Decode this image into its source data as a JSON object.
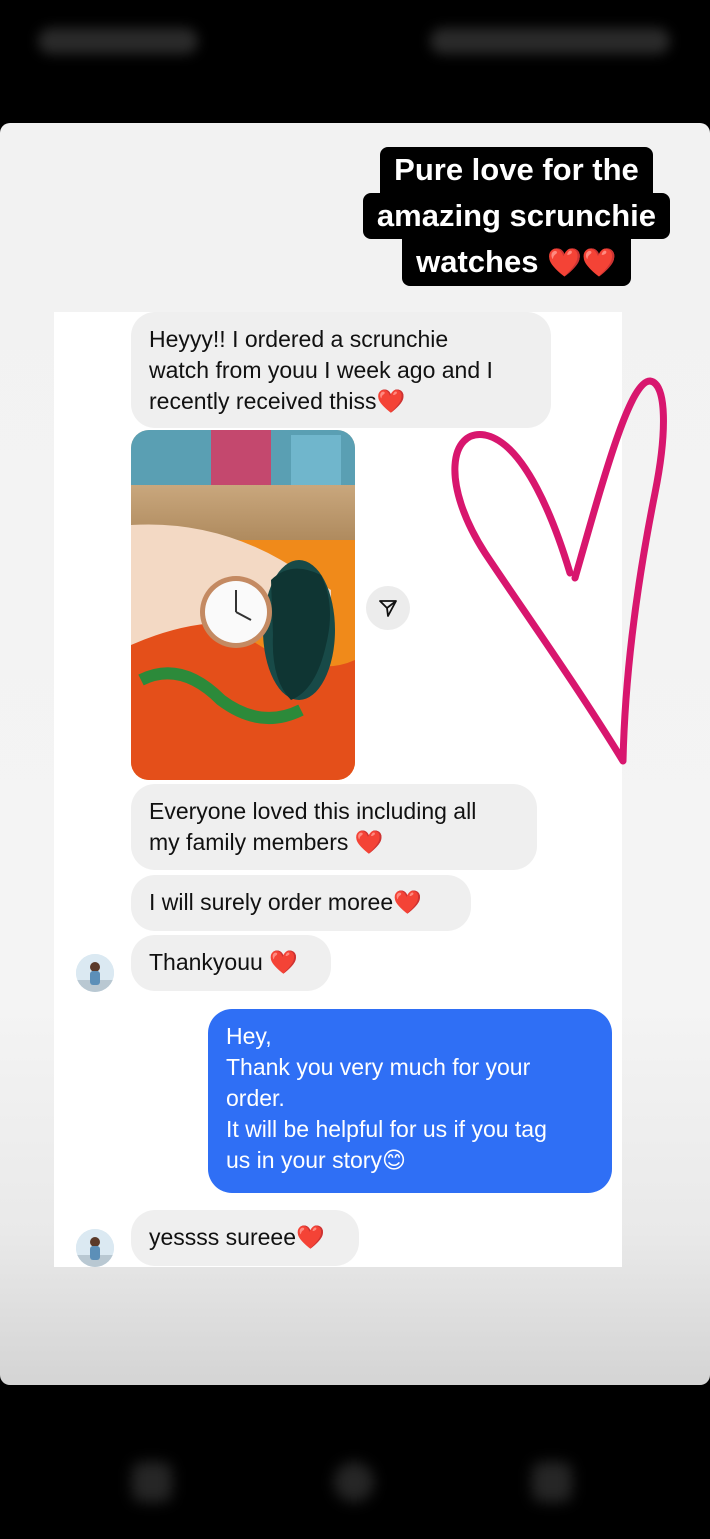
{
  "status_bar": {
    "time": "2:30",
    "icons": [
      "notification-icons",
      "battery-signal-icons"
    ]
  },
  "story": {
    "caption_lines": [
      "Pure love for the",
      "amazing scrunchie",
      "watches"
    ],
    "caption_emoji": "❤️❤️",
    "decoration": "pink-heart-drawing"
  },
  "chat": {
    "messages": [
      {
        "direction": "incoming",
        "lines": [
          "Heyyy!! I ordered a scrunchie",
          "watch from youu I week ago and I",
          "recently received thiss"
        ],
        "emoji": "❤️"
      },
      {
        "direction": "incoming",
        "type": "photo",
        "description_icon": "scrunchie-watch-photo"
      },
      {
        "direction": "incoming",
        "lines": [
          "Everyone loved this including all",
          "my family members"
        ],
        "emoji": "❤️"
      },
      {
        "direction": "incoming",
        "lines": [
          "I will surely order moree"
        ],
        "emoji": "❤️"
      },
      {
        "direction": "incoming",
        "lines": [
          "Thankyouu"
        ],
        "emoji": "❤️"
      },
      {
        "direction": "outgoing",
        "lines": [
          "Hey,",
          "Thank you very much for your",
          "order.",
          "It will be helpful for us if you tag",
          "us in your story"
        ],
        "emoji": "😊"
      },
      {
        "direction": "incoming",
        "lines": [
          "yessss sureee"
        ],
        "emoji": "❤️"
      }
    ],
    "share_icon": "share-arrow-icon",
    "accent_color": "#2f6ff5",
    "heart_color": "#d8166e"
  },
  "nav_bar": {
    "icons": [
      "recent-apps-icon",
      "home-icon",
      "back-icon"
    ]
  }
}
